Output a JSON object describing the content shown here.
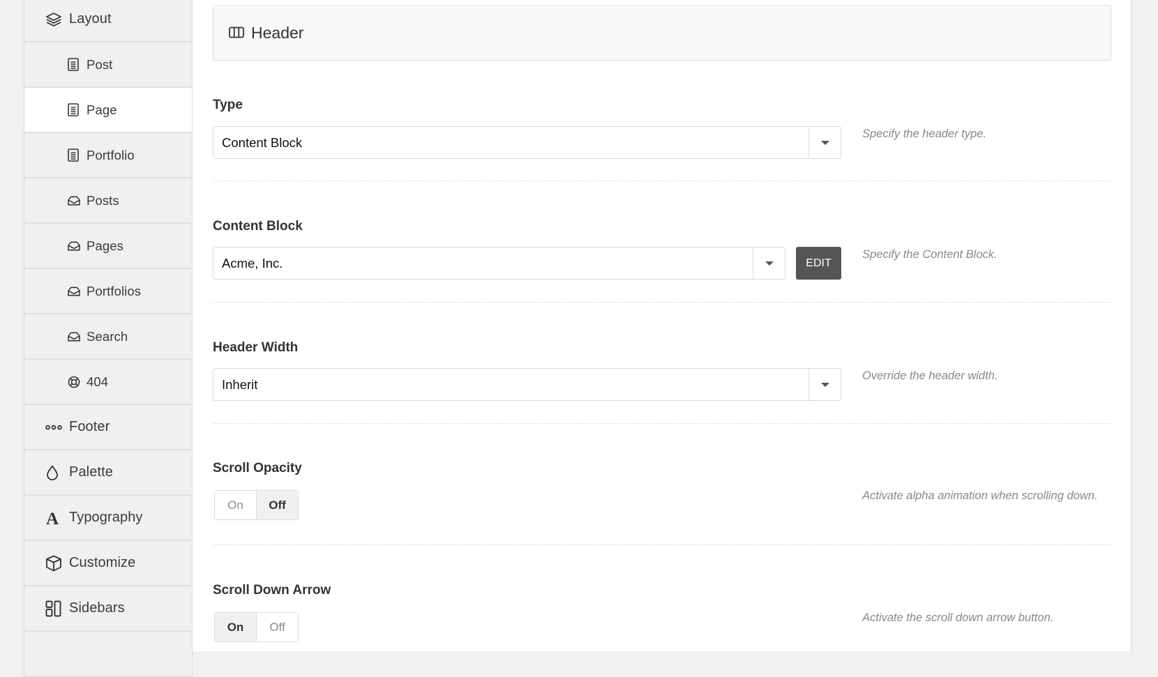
{
  "sidebar": {
    "items": [
      {
        "label": "Layout",
        "icon": "layers-icon",
        "level": "top",
        "active": false
      },
      {
        "label": "Post",
        "icon": "document-icon",
        "level": "sub",
        "active": false
      },
      {
        "label": "Page",
        "icon": "document-icon",
        "level": "sub",
        "active": true
      },
      {
        "label": "Portfolio",
        "icon": "document-icon",
        "level": "sub",
        "active": false
      },
      {
        "label": "Posts",
        "icon": "inbox-icon",
        "level": "sub",
        "active": false
      },
      {
        "label": "Pages",
        "icon": "inbox-icon",
        "level": "sub",
        "active": false
      },
      {
        "label": "Portfolios",
        "icon": "inbox-icon",
        "level": "sub",
        "active": false
      },
      {
        "label": "Search",
        "icon": "inbox-icon",
        "level": "sub",
        "active": false
      },
      {
        "label": "404",
        "icon": "life-ring-icon",
        "level": "sub",
        "active": false
      },
      {
        "label": "Footer",
        "icon": "ellipsis-icon",
        "level": "top",
        "active": false
      },
      {
        "label": "Palette",
        "icon": "droplet-icon",
        "level": "top",
        "active": false
      },
      {
        "label": "Typography",
        "icon": "font-icon",
        "level": "top",
        "active": false
      },
      {
        "label": "Customize",
        "icon": "cube-icon",
        "level": "top",
        "active": false
      },
      {
        "label": "Sidebars",
        "icon": "sidebars-icon",
        "level": "top",
        "active": false
      },
      {
        "label": "",
        "icon": "",
        "level": "top",
        "active": false
      }
    ]
  },
  "section": {
    "title": "Header",
    "icon": "columns-icon"
  },
  "fields": {
    "type": {
      "label": "Type",
      "value": "Content Block",
      "help": "Specify the header type."
    },
    "content_block": {
      "label": "Content Block",
      "value": "Acme, Inc.",
      "edit_label": "EDIT",
      "help": "Specify the Content Block."
    },
    "header_width": {
      "label": "Header Width",
      "value": "Inherit",
      "help": "Override the header width."
    },
    "scroll_opacity": {
      "label": "Scroll Opacity",
      "on_label": "On",
      "off_label": "Off",
      "value": "Off",
      "help": "Activate alpha animation when scrolling down."
    },
    "scroll_down_arrow": {
      "label": "Scroll Down Arrow",
      "on_label": "On",
      "off_label": "Off",
      "value": "On",
      "help": "Activate the scroll down arrow button."
    }
  },
  "colors": {
    "page_bg": "#f1f1f1",
    "sidebar_bg": "#f0f0f0",
    "active_bg": "#ffffff",
    "edit_button": "#555555",
    "help_text": "#888888"
  }
}
